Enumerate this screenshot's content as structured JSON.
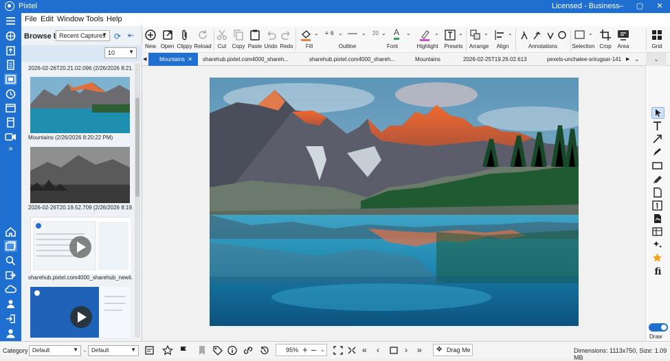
{
  "app": {
    "title": "Pixtel",
    "license": "Licensed - Business"
  },
  "window_controls": {
    "minimize": "–",
    "maximize": "▢",
    "close": "✕"
  },
  "menu": [
    "File",
    "Edit",
    "Window",
    "Tools",
    "Help"
  ],
  "browse": {
    "label": "Browse by:",
    "source": "Recent Captures",
    "count": "10"
  },
  "thumbnails": [
    {
      "caption": "2026-02-26T20.21.02.096 (2/26/2026 8:21...",
      "kind": "partial"
    },
    {
      "caption": "Mountains (2/26/2026 8:20:22 PM)",
      "kind": "mountain-lake"
    },
    {
      "caption": "2026-02-26T20.19.52.709 (2/26/2026 8:19...",
      "kind": "mountain-bw"
    },
    {
      "caption": "sharehub.pixtel.com4000_sharehub_newli...",
      "kind": "video-web"
    },
    {
      "caption": "",
      "kind": "video-blue"
    }
  ],
  "ribbon": {
    "new": "New",
    "open": "Open",
    "clippy": "Clippy",
    "reload": "Reload",
    "cut": "Cut",
    "copy": "Copy",
    "paste": "Paste",
    "undo": "Undo",
    "redo": "Redo",
    "fill": "Fill",
    "outline": "Outline",
    "outline_width": "6",
    "font": "Font",
    "font_size": "20",
    "highlight": "Highlight",
    "presets": "Presets",
    "arrange": "Arrange",
    "align": "Align",
    "annotations": "Annotations",
    "selection": "Selection",
    "crop": "Crop",
    "area": "Area",
    "grid": "Grid"
  },
  "tabs": [
    {
      "label": "Mountains",
      "active": true
    },
    {
      "label": "sharehub.pixtel.com4000_shareh...",
      "active": false
    },
    {
      "label": "sharehub.pixtel.com4000_shareh...",
      "active": false
    },
    {
      "label": "Mountains",
      "active": false
    },
    {
      "label": "2026-02-25T19.26.02.613",
      "active": false
    },
    {
      "label": "pexels-unchalee-srirugsar-141",
      "active": false
    }
  ],
  "draw": {
    "label": "Draw",
    "enabled": true
  },
  "status": {
    "category_label": "Category",
    "category_value": "Default",
    "category_sep": "-",
    "second_value": "Default",
    "zoom": "95%",
    "drag_me": "Drag Me",
    "dimensions": "Dimensions: 1113x750, Size: 1.09 MB"
  },
  "colors": {
    "accent": "#1e6fcf",
    "fill_swatch": "#e8823a",
    "font_swatch": "#2e9e4f",
    "highlight_swatch": "#d24fc8"
  }
}
